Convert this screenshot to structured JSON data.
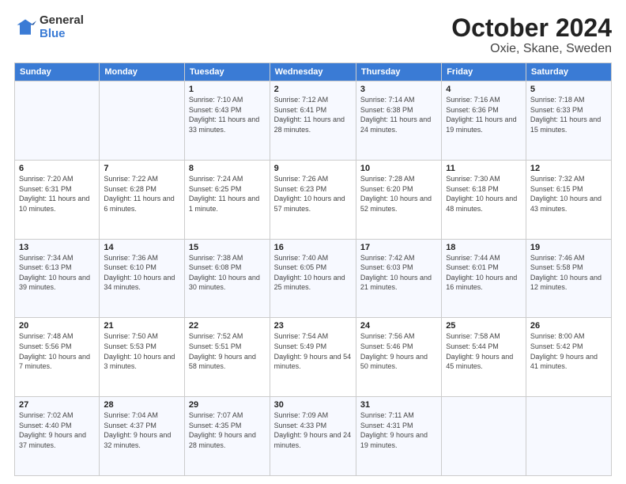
{
  "header": {
    "logo_line1": "General",
    "logo_line2": "Blue",
    "title": "October 2024",
    "subtitle": "Oxie, Skane, Sweden"
  },
  "days_of_week": [
    "Sunday",
    "Monday",
    "Tuesday",
    "Wednesday",
    "Thursday",
    "Friday",
    "Saturday"
  ],
  "weeks": [
    [
      {
        "day": "",
        "text": ""
      },
      {
        "day": "",
        "text": ""
      },
      {
        "day": "1",
        "text": "Sunrise: 7:10 AM\nSunset: 6:43 PM\nDaylight: 11 hours and 33 minutes."
      },
      {
        "day": "2",
        "text": "Sunrise: 7:12 AM\nSunset: 6:41 PM\nDaylight: 11 hours and 28 minutes."
      },
      {
        "day": "3",
        "text": "Sunrise: 7:14 AM\nSunset: 6:38 PM\nDaylight: 11 hours and 24 minutes."
      },
      {
        "day": "4",
        "text": "Sunrise: 7:16 AM\nSunset: 6:36 PM\nDaylight: 11 hours and 19 minutes."
      },
      {
        "day": "5",
        "text": "Sunrise: 7:18 AM\nSunset: 6:33 PM\nDaylight: 11 hours and 15 minutes."
      }
    ],
    [
      {
        "day": "6",
        "text": "Sunrise: 7:20 AM\nSunset: 6:31 PM\nDaylight: 11 hours and 10 minutes."
      },
      {
        "day": "7",
        "text": "Sunrise: 7:22 AM\nSunset: 6:28 PM\nDaylight: 11 hours and 6 minutes."
      },
      {
        "day": "8",
        "text": "Sunrise: 7:24 AM\nSunset: 6:25 PM\nDaylight: 11 hours and 1 minute."
      },
      {
        "day": "9",
        "text": "Sunrise: 7:26 AM\nSunset: 6:23 PM\nDaylight: 10 hours and 57 minutes."
      },
      {
        "day": "10",
        "text": "Sunrise: 7:28 AM\nSunset: 6:20 PM\nDaylight: 10 hours and 52 minutes."
      },
      {
        "day": "11",
        "text": "Sunrise: 7:30 AM\nSunset: 6:18 PM\nDaylight: 10 hours and 48 minutes."
      },
      {
        "day": "12",
        "text": "Sunrise: 7:32 AM\nSunset: 6:15 PM\nDaylight: 10 hours and 43 minutes."
      }
    ],
    [
      {
        "day": "13",
        "text": "Sunrise: 7:34 AM\nSunset: 6:13 PM\nDaylight: 10 hours and 39 minutes."
      },
      {
        "day": "14",
        "text": "Sunrise: 7:36 AM\nSunset: 6:10 PM\nDaylight: 10 hours and 34 minutes."
      },
      {
        "day": "15",
        "text": "Sunrise: 7:38 AM\nSunset: 6:08 PM\nDaylight: 10 hours and 30 minutes."
      },
      {
        "day": "16",
        "text": "Sunrise: 7:40 AM\nSunset: 6:05 PM\nDaylight: 10 hours and 25 minutes."
      },
      {
        "day": "17",
        "text": "Sunrise: 7:42 AM\nSunset: 6:03 PM\nDaylight: 10 hours and 21 minutes."
      },
      {
        "day": "18",
        "text": "Sunrise: 7:44 AM\nSunset: 6:01 PM\nDaylight: 10 hours and 16 minutes."
      },
      {
        "day": "19",
        "text": "Sunrise: 7:46 AM\nSunset: 5:58 PM\nDaylight: 10 hours and 12 minutes."
      }
    ],
    [
      {
        "day": "20",
        "text": "Sunrise: 7:48 AM\nSunset: 5:56 PM\nDaylight: 10 hours and 7 minutes."
      },
      {
        "day": "21",
        "text": "Sunrise: 7:50 AM\nSunset: 5:53 PM\nDaylight: 10 hours and 3 minutes."
      },
      {
        "day": "22",
        "text": "Sunrise: 7:52 AM\nSunset: 5:51 PM\nDaylight: 9 hours and 58 minutes."
      },
      {
        "day": "23",
        "text": "Sunrise: 7:54 AM\nSunset: 5:49 PM\nDaylight: 9 hours and 54 minutes."
      },
      {
        "day": "24",
        "text": "Sunrise: 7:56 AM\nSunset: 5:46 PM\nDaylight: 9 hours and 50 minutes."
      },
      {
        "day": "25",
        "text": "Sunrise: 7:58 AM\nSunset: 5:44 PM\nDaylight: 9 hours and 45 minutes."
      },
      {
        "day": "26",
        "text": "Sunrise: 8:00 AM\nSunset: 5:42 PM\nDaylight: 9 hours and 41 minutes."
      }
    ],
    [
      {
        "day": "27",
        "text": "Sunrise: 7:02 AM\nSunset: 4:40 PM\nDaylight: 9 hours and 37 minutes."
      },
      {
        "day": "28",
        "text": "Sunrise: 7:04 AM\nSunset: 4:37 PM\nDaylight: 9 hours and 32 minutes."
      },
      {
        "day": "29",
        "text": "Sunrise: 7:07 AM\nSunset: 4:35 PM\nDaylight: 9 hours and 28 minutes."
      },
      {
        "day": "30",
        "text": "Sunrise: 7:09 AM\nSunset: 4:33 PM\nDaylight: 9 hours and 24 minutes."
      },
      {
        "day": "31",
        "text": "Sunrise: 7:11 AM\nSunset: 4:31 PM\nDaylight: 9 hours and 19 minutes."
      },
      {
        "day": "",
        "text": ""
      },
      {
        "day": "",
        "text": ""
      }
    ]
  ]
}
